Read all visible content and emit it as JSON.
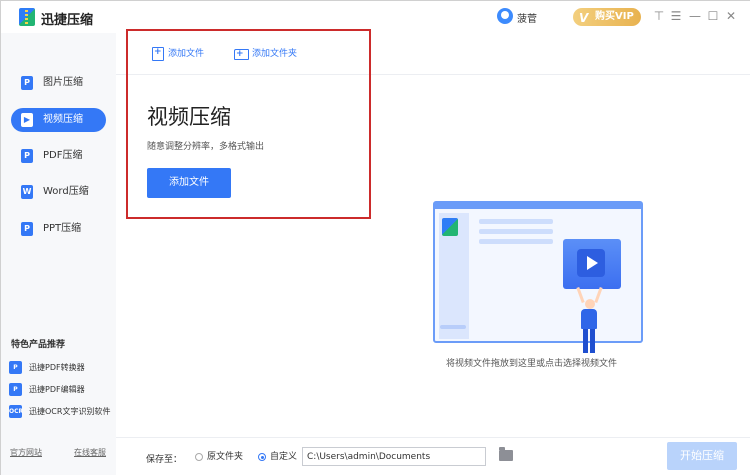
{
  "app": {
    "title": "迅捷压缩"
  },
  "header": {
    "user_name": "菠菅",
    "vip_label": "购买VIP",
    "vip_icon": "V"
  },
  "window_controls": {
    "skin": "⊤",
    "menu": "☰",
    "minimize": "—",
    "maximize": "☐",
    "close": "✕"
  },
  "sidebar": {
    "items": [
      {
        "label": "图片压缩",
        "icon": "P"
      },
      {
        "label": "视频压缩",
        "icon": "▶"
      },
      {
        "label": "PDF压缩",
        "icon": "P"
      },
      {
        "label": "Word压缩",
        "icon": "W"
      },
      {
        "label": "PPT压缩",
        "icon": "P"
      }
    ],
    "featured_title": "特色产品推荐",
    "products": [
      {
        "label": "迅捷PDF转换器",
        "icon": "P"
      },
      {
        "label": "迅捷PDF编辑器",
        "icon": "P"
      },
      {
        "label": "迅捷OCR文字识别软件",
        "icon": "OCR"
      }
    ],
    "footer": {
      "website": "官方网站",
      "support": "在线客服"
    }
  },
  "toolbar": {
    "add_file": "添加文件",
    "add_folder": "添加文件夹"
  },
  "main": {
    "title": "视频压缩",
    "subtitle": "随意调整分辨率，多格式输出",
    "add_file_button": "添加文件",
    "drop_hint": "将视频文件拖放到这里或点击选择视频文件"
  },
  "bottom": {
    "save_to_label": "保存至：",
    "option_original": "原文件夹",
    "option_custom": "自定义",
    "path_value": "C:\\Users\\admin\\Documents",
    "start_button": "开始压缩"
  },
  "colors": {
    "accent": "#3478f6",
    "highlight": "#cc2b2b",
    "vip": "#e8b24f",
    "start_disabled": "#b9d3fb"
  }
}
